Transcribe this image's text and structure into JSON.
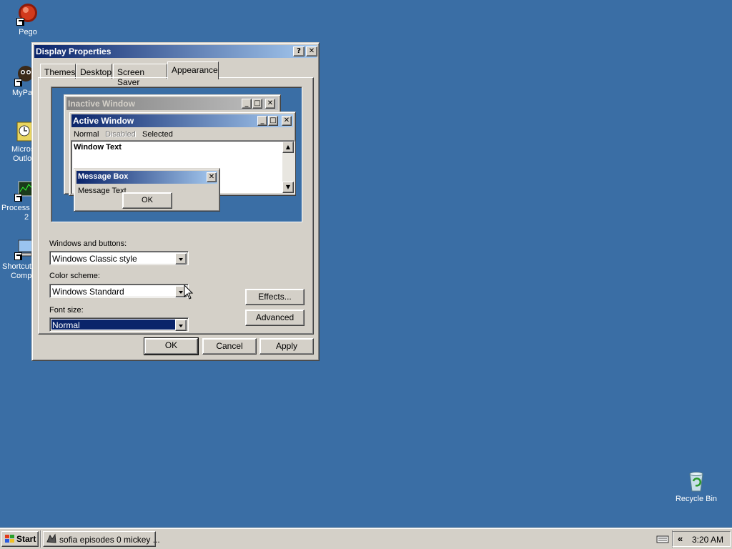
{
  "desktop": {
    "icons": [
      {
        "label": "Pego",
        "icon": "pego-icon"
      },
      {
        "label": "MyPa",
        "icon": "mypal-icon"
      },
      {
        "label": "Micros",
        "label2": "Outlo",
        "icon": "outlook-icon"
      },
      {
        "label": "Process M",
        "label2": "2",
        "icon": "process-monitor-icon"
      },
      {
        "label": "Shortcut",
        "label2": "Comp",
        "icon": "computer-shortcut-icon"
      }
    ],
    "recycle_bin": {
      "label": "Recycle Bin",
      "icon": "recycle-bin-icon"
    }
  },
  "dialog": {
    "title": "Display Properties",
    "help_button": "?",
    "close_button": "✕",
    "tabs": [
      "Themes",
      "Desktop",
      "Screen Saver",
      "Appearance"
    ],
    "active_tab": "Appearance",
    "preview": {
      "inactive_title": "Inactive Window",
      "active_title": "Active Window",
      "menu": {
        "normal": "Normal",
        "disabled": "Disabled",
        "selected": "Selected"
      },
      "window_text": "Window Text",
      "message_box_title": "Message Box",
      "message_text": "Message Text",
      "ok": "OK"
    },
    "windows_buttons": {
      "label": "Windows and buttons:",
      "value": "Windows Classic style"
    },
    "color_scheme": {
      "label": "Color scheme:",
      "value": "Windows Standard"
    },
    "font_size": {
      "label": "Font size:",
      "value": "Normal"
    },
    "effects_button": "Effects...",
    "advanced_button": "Advanced",
    "ok_button": "OK",
    "cancel_button": "Cancel",
    "apply_button": "Apply"
  },
  "taskbar": {
    "start_label": "Start",
    "task_label": "sofia episodes 0 mickey ...",
    "tray_chevron": "«",
    "clock": "3:20 AM"
  },
  "colors": {
    "desktop": "#3a6ea5",
    "face": "#d4d0c8",
    "active_title_start": "#0a246a",
    "active_title_end": "#a6caf0"
  }
}
